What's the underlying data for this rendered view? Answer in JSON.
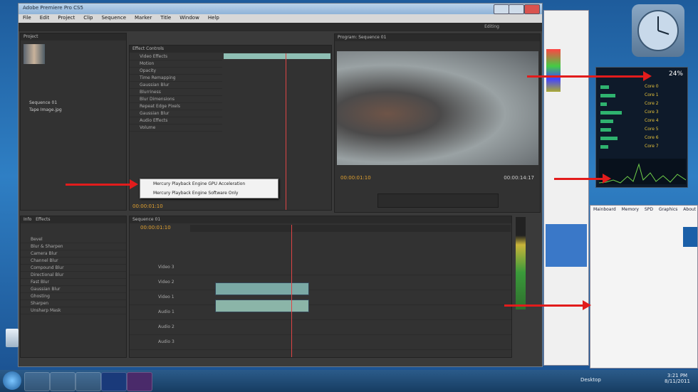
{
  "premiere": {
    "title": "Adobe Premiere Pro CS5",
    "menu": [
      "File",
      "Edit",
      "Project",
      "Clip",
      "Sequence",
      "Marker",
      "Title",
      "Window",
      "Help"
    ],
    "workspace": "Editing",
    "project": {
      "tabs": [
        "Project",
        "Info",
        "Effects"
      ],
      "items": [
        "Sequence 01",
        "Tape Image.jpg"
      ]
    },
    "effect_controls": {
      "tab": "Effect Controls",
      "rows": [
        "Video Effects",
        "Motion",
        "Opacity",
        "Time Remapping",
        "Gaussian Blur",
        "Blurriness",
        "Blur Dimensions",
        "Repeat Edge Pixels",
        "Gaussian Blur",
        "Audio Effects",
        "Volume"
      ]
    },
    "program_timecode_left": "00:00:01:10",
    "program_timecode_right": "00:00:14:17",
    "effects_tree": [
      "Bevel",
      "Blur & Sharpen",
      "Camera Blur",
      "Channel Blur",
      "Compound Blur",
      "Directional Blur",
      "Fast Blur",
      "Gaussian Blur",
      "Ghosting",
      "Sharpen",
      "Unsharp Mask"
    ],
    "timeline": {
      "tab": "Sequence 01",
      "timecode": "00:00:01:10",
      "tracks": [
        "Video 3",
        "Video 2",
        "Video 1",
        "Audio 1",
        "Audio 2",
        "Audio 3"
      ]
    },
    "context_menu": [
      "Mercury Playback Engine GPU Acceleration",
      "Mercury Playback Engine Software Only"
    ]
  },
  "meter": {
    "percent": "24%",
    "labels": [
      "Core 0",
      "Core 1",
      "Core 2",
      "Core 3",
      "Core 4",
      "Core 5",
      "Core 6",
      "Core 7"
    ]
  },
  "cpuz": {
    "tabs": [
      "Mainboard",
      "Memory",
      "SPD",
      "Graphics",
      "About"
    ]
  },
  "taskbar": {
    "time": "3:21 PM",
    "date": "8/11/2011",
    "lang": "Desktop"
  },
  "colors": {
    "arrow": "#e21c1c",
    "timecode": "#e0a030"
  }
}
